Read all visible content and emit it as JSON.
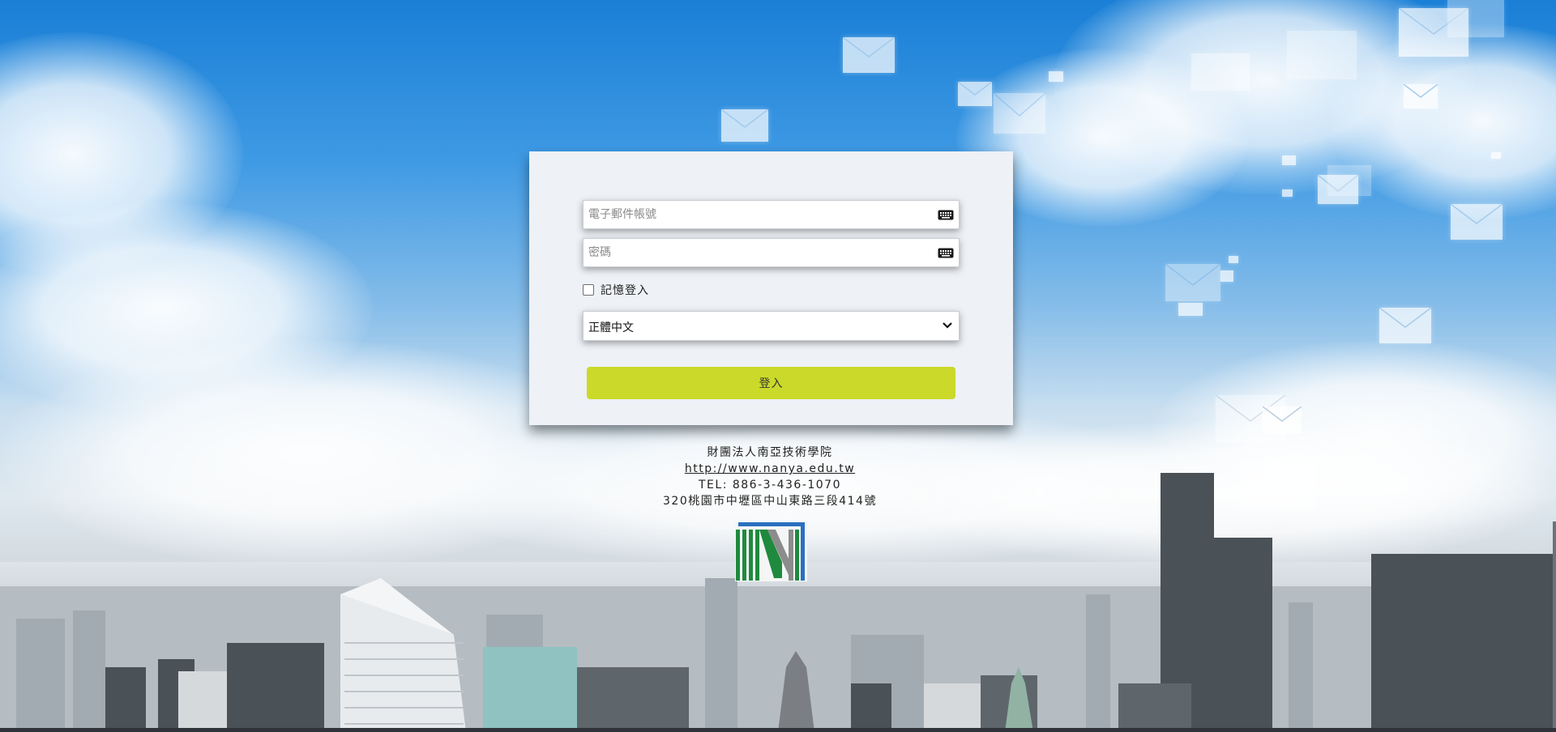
{
  "login_form": {
    "email_placeholder": "電子郵件帳號",
    "password_placeholder": "密碼",
    "keyboard_icon": "keyboard-icon",
    "remember_label": "記憶登入",
    "remember_checked": false,
    "language_selected": "正體中文",
    "login_button": "登入"
  },
  "footer": {
    "org_name": "財團法人南亞技術學院",
    "url": "http://www.nanya.edu.tw",
    "tel": "TEL: 886-3-436-1070",
    "address": "320桃園市中壢區中山東路三段414號"
  },
  "colors": {
    "login_button": "#cbd92a",
    "panel_bg": "#eef1f6",
    "logo_green": "#1f8a3e",
    "logo_blue": "#2a6fc0",
    "logo_gray": "#8c8c8c"
  }
}
